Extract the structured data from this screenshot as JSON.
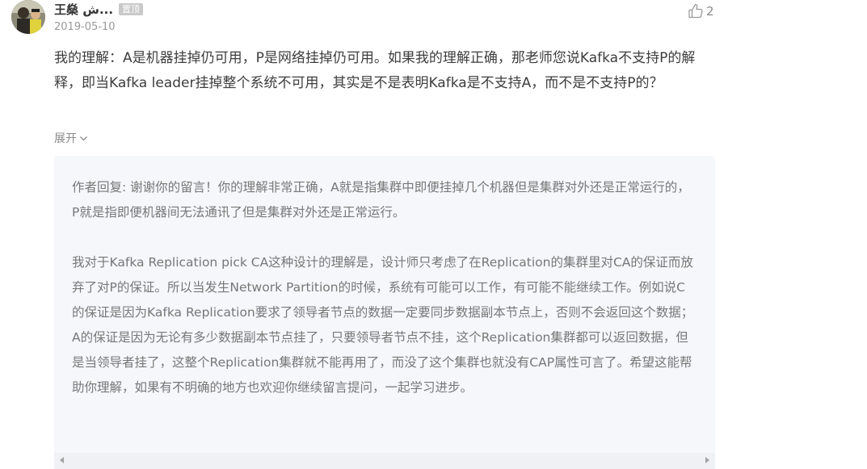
{
  "comment": {
    "username": "王燊 ش...",
    "pinned_badge": "置顶",
    "date": "2019-05-10",
    "like_count": "2",
    "text": "我的理解：A是机器挂掉仍可用，P是网络挂掉仍可用。如果我的理解正确，那老师您说Kafka不支持P的解释，即当Kafka leader挂掉整个系统不可用，其实是不是表明Kafka是不支持A，而不是不支持P的？",
    "expand_label": "展开",
    "icons": {
      "avatar": "avatar-photo",
      "like": "thumbs-up-icon",
      "expand": "chevron-down-icon"
    }
  },
  "reply": {
    "paragraph_1": "作者回复: 谢谢你的留言！你的理解非常正确，A就是指集群中即便挂掉几个机器但是集群对外还是正常运行的，P就是指即便机器间无法通讯了但是集群对外还是正常运行。",
    "paragraph_2": "我对于Kafka Replication pick CA这种设计的理解是，设计师只考虑了在Replication的集群里对CA的保证而放弃了对P的保证。所以当发生Network Partition的时候，系统有可能可以工作，有可能不能继续工作。例如说C的保证是因为Kafka Replication要求了领导者节点的数据一定要同步数据副本节点上，否则不会返回这个数据；A的保证是因为无论有多少数据副本节点挂了，只要领导者节点不挂，这个Replication集群都可以返回数据，但是当领导者挂了，这整个Replication集群就不能再用了，而没了这个集群也就没有CAP属性可言了。希望这能帮助你理解，如果有不明确的地方也欢迎你继续留言提问，一起学习进步。"
  },
  "colors": {
    "reply_background": "#f6f7fb",
    "muted_text": "#999999",
    "badge_background": "#c9c9c9"
  }
}
